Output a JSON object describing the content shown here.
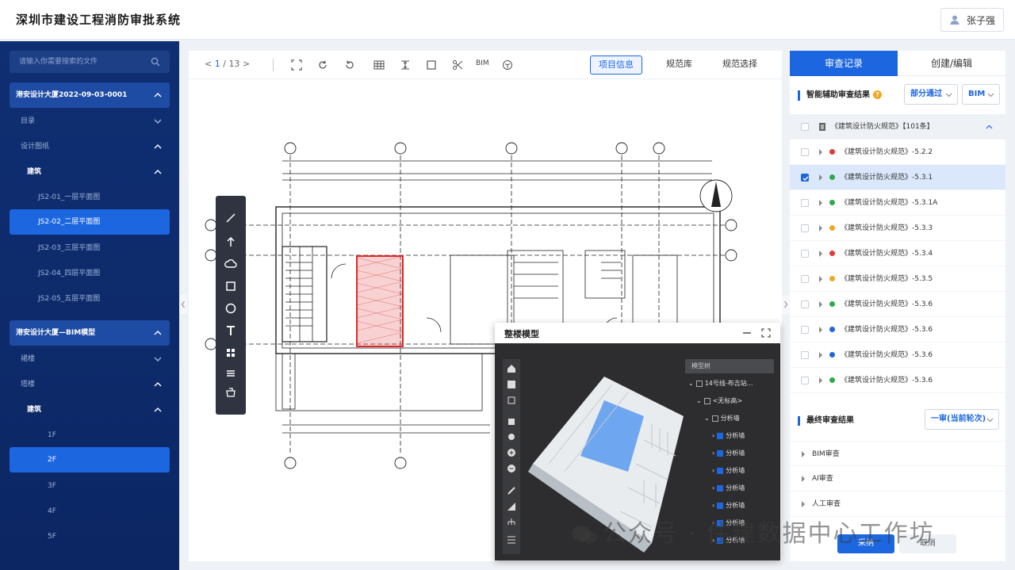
{
  "header": {
    "title": "深圳市建设工程消防审批系统",
    "user": "张子强"
  },
  "sidebar": {
    "search_placeholder": "请输入你需要搜索的文件",
    "project1": "港安设计大厦2022-09-03-0001",
    "p1_catalog": "目录",
    "p1_drawings": "设计图纸",
    "p1_arch": "建筑",
    "p1_files": [
      "JS2-01_一层平面图",
      "JS2-02_二层平面图",
      "JS2-03_三层平面图",
      "JS2-04_四层平面图",
      "JS2-05_五层平面图"
    ],
    "project2": "港安设计大厦—BIM模型",
    "p2_podium": "裙楼",
    "p2_tower": "塔楼",
    "p2_arch": "建筑",
    "floors": [
      "1F",
      "2F",
      "3F",
      "4F",
      "5F"
    ]
  },
  "viewer": {
    "page_current": "1",
    "page_total": "13",
    "bim_label": "BIM",
    "tabs": [
      "项目信息",
      "规范库",
      "规范选择"
    ],
    "active_tab": "项目信息"
  },
  "model": {
    "title": "整楼模型",
    "tree_header": "模型树",
    "tree_root": "14号线-布吉站...",
    "tree_level": "<无标高>",
    "tree_group": "分析墙",
    "tree_items": [
      "分析墙",
      "分析墙",
      "分析墙",
      "分析墙",
      "分析墙",
      "分析墙",
      "分析墙"
    ]
  },
  "review": {
    "tab_records": "审查记录",
    "tab_edit": "创建/编辑",
    "ai_title": "智能辅助审查结果",
    "ai_status": "部分通过",
    "ai_source": "BIM",
    "group_label": "《建筑设计防火规范》【101条】",
    "rules": [
      {
        "label": "《建筑设计防火规范》-5.2.2",
        "color": "#e53935",
        "checked": false
      },
      {
        "label": "《建筑设计防火规范》-5.3.1",
        "color": "#2eaa4a",
        "checked": true
      },
      {
        "label": "《建筑设计防火规范》-5.3.1A",
        "color": "#2eaa4a",
        "checked": false
      },
      {
        "label": "《建筑设计防火规范》-5.3.3",
        "color": "#f5a623",
        "checked": false
      },
      {
        "label": "《建筑设计防火规范》-5.3.4",
        "color": "#e53935",
        "checked": false
      },
      {
        "label": "《建筑设计防火规范》-5.3.5",
        "color": "#f5a623",
        "checked": false
      },
      {
        "label": "《建筑设计防火规范》-5.3.6",
        "color": "#2eaa4a",
        "checked": false
      },
      {
        "label": "《建筑设计防火规范》-5.3.6",
        "color": "#1c66e0",
        "checked": false
      },
      {
        "label": "《建筑设计防火规范》-5.3.6",
        "color": "#1c66e0",
        "checked": false
      },
      {
        "label": "《建筑设计防火规范》-5.3.6",
        "color": "#2eaa4a",
        "checked": false
      }
    ],
    "final_title": "最终审查结果",
    "final_round": "一审(当前轮次)",
    "final_items": [
      "BIM审查",
      "AI审查",
      "人工审查"
    ],
    "accept": "采纳",
    "cancel": "取消"
  },
  "watermark": "公众号 · 住建数据中心工作坊"
}
